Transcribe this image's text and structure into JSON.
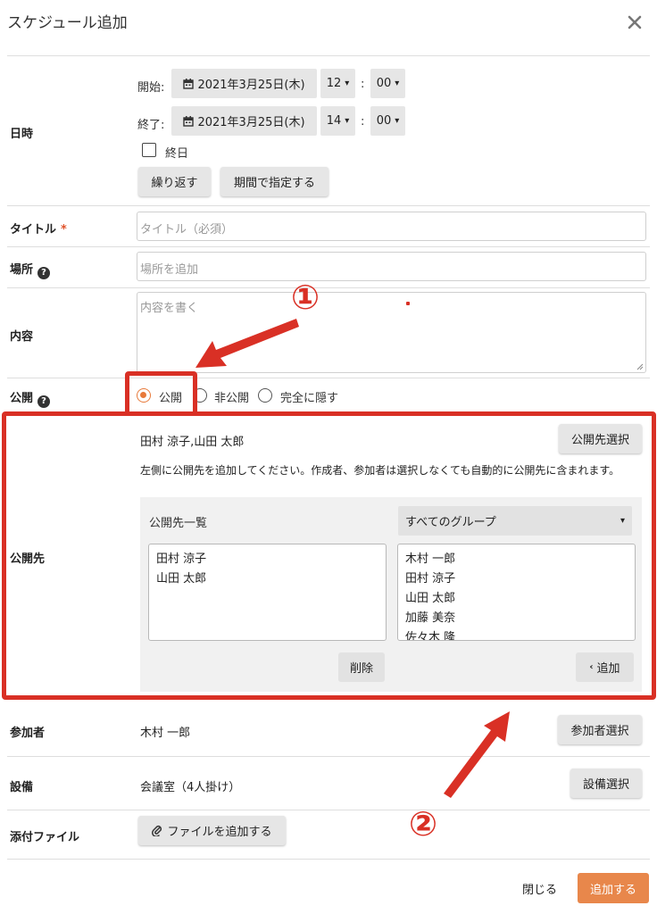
{
  "dialog": {
    "title": "スケジュール追加"
  },
  "datetime": {
    "label": "日時",
    "start_label": "開始:",
    "start_date": "2021年3月25日(木)",
    "start_hour": "12",
    "start_minute": "00",
    "end_label": "終了:",
    "end_date": "2021年3月25日(木)",
    "end_hour": "14",
    "end_minute": "00",
    "time_separator": ":",
    "allday_label": "終日",
    "repeat_button": "繰り返す",
    "period_button": "期間で指定する"
  },
  "title_field": {
    "label": "タイトル",
    "required_mark": "*",
    "placeholder": "タイトル（必須）"
  },
  "location": {
    "label": "場所",
    "placeholder": "場所を追加"
  },
  "content": {
    "label": "内容",
    "placeholder": "内容を書く"
  },
  "visibility": {
    "label": "公開",
    "options": [
      "公開",
      "非公開",
      "完全に隠す"
    ],
    "selected": "公開"
  },
  "audience": {
    "label": "公開先",
    "selected_names": "田村 涼子,山田 太郎",
    "select_button": "公開先選択",
    "note": "左側に公開先を追加してください。作成者、参加者は選択しなくても自動的に公開先に含まれます。",
    "list_title": "公開先一覧",
    "group_select": "すべてのグループ",
    "left_list": [
      "田村 涼子",
      "山田 太郎"
    ],
    "right_list": [
      "木村 一郎",
      "田村 涼子",
      "山田 太郎",
      "加藤 美奈",
      "佐々木 隆"
    ],
    "delete_button": "削除",
    "add_button": "追加"
  },
  "participants": {
    "label": "参加者",
    "value": "木村 一郎",
    "button": "参加者選択"
  },
  "equipment": {
    "label": "設備",
    "value": "会議室（4人掛け）",
    "button": "設備選択"
  },
  "attachment": {
    "label": "添付ファイル",
    "button": "ファイルを追加する"
  },
  "footer": {
    "close": "閉じる",
    "submit": "追加する"
  },
  "annotations": {
    "marker1": "①",
    "marker2": "②"
  },
  "colors": {
    "accent": "#e8874b",
    "annotation_red": "#d93025"
  }
}
